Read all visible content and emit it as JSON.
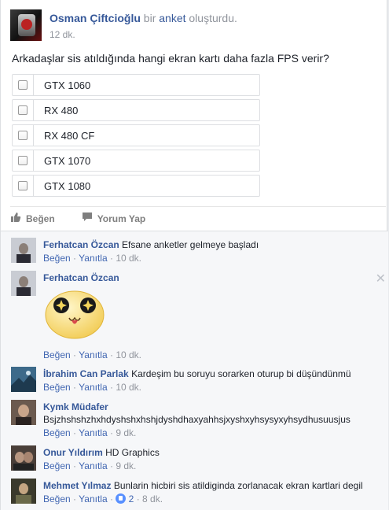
{
  "post": {
    "author": "Osman Çiftcioğlu",
    "action_prefix": "bir",
    "action_link": "anket",
    "action_suffix": "oluşturdu.",
    "time": "12 dk.",
    "question": "Arkadaşlar sis atıldığında hangi ekran kartı daha fazla FPS verir?"
  },
  "poll": {
    "options": [
      "GTX 1060",
      "RX 480",
      "RX 480 CF",
      "GTX 1070",
      "GTX 1080"
    ]
  },
  "actions": {
    "like": "Beğen",
    "comment": "Yorum Yap"
  },
  "meta": {
    "like": "Beğen",
    "reply": "Yanıtla",
    "sep": "·"
  },
  "comments": [
    {
      "name": "Ferhatcan Özcan",
      "text": "Efsane anketler gelmeye başladı",
      "time": "10 dk."
    },
    {
      "name": "Ferhatcan Özcan",
      "text": "",
      "time": "10 dk."
    },
    {
      "name": "İbrahim Can Parlak",
      "text": "Kardeşim bu soruyu sorarken oturup bi düşündünmü",
      "time": "10 dk."
    },
    {
      "name": "Kymk Müdafer",
      "text": "Bsjzhshshzhxhdyshshxhshjdyshdhaxyahhsjxyshxyhsysyxyhsydhusuusjus",
      "time": "9 dk."
    },
    {
      "name": "Onur Yıldırım",
      "text": "HD Graphics",
      "time": "9 dk."
    },
    {
      "name": "Mehmet Yılmaz",
      "text": "Bunlarin hicbiri sis atildiginda zorlanacak ekran kartlari degil",
      "time": "8 dk.",
      "likes": "2"
    }
  ],
  "icons": {
    "close": "close-icon",
    "like": "thumbs-up-icon",
    "comment": "comment-bubble-icon"
  },
  "colors": {
    "link": "#365899",
    "meta_link": "#4267b2",
    "muted": "#90949c",
    "comment_bg": "#f6f7f9"
  }
}
